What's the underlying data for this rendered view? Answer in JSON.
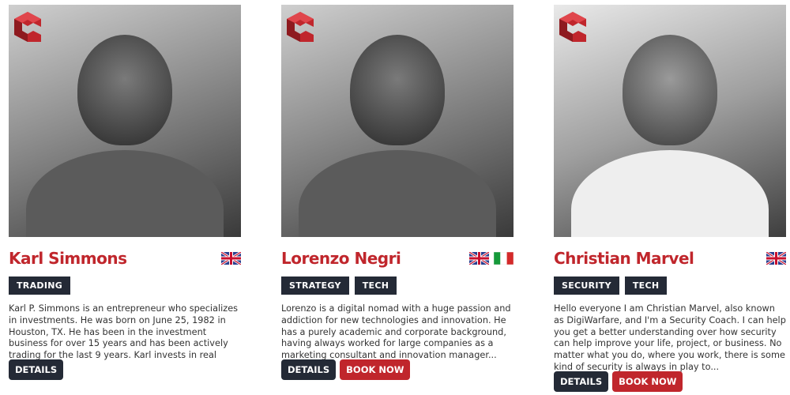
{
  "cards": [
    {
      "name": "Karl Simmons",
      "flags": [
        "uk-flag-icon"
      ],
      "tags": [
        "TRADING"
      ],
      "bio": "Karl P. Simmons is an entrepreneur who specializes in investments. He was born on June 25, 1982 in Houston, TX. He has been in the investment business for over 15 years and has been actively trading for the last 9 years. Karl invests in real estate as well as the...",
      "details_label": "DETAILS"
    },
    {
      "name": "Lorenzo Negri",
      "flags": [
        "uk-flag-icon",
        "italy-flag-icon"
      ],
      "tags": [
        "STRATEGY",
        "TECH"
      ],
      "bio": "Lorenzo is a digital nomad with a huge passion and addiction for new technologies and innovation. He has a purely academic and corporate background, having always worked for large companies as a marketing consultant and innovation manager...",
      "details_label": "DETAILS",
      "book_label": "BOOK NOW"
    },
    {
      "name": "Christian Marvel",
      "flags": [
        "uk-flag-icon"
      ],
      "tags": [
        "SECURITY",
        "TECH"
      ],
      "bio": "Hello everyone I am Christian Marvel, also known as DigiWarfare, and I'm a Security Coach. I can help you get a better understanding over how security can help improve your life, project, or business. No matter what you do, where you work, there is some kind of security is always in play to...",
      "details_label": "DETAILS",
      "book_label": "BOOK NOW"
    }
  ],
  "colors": {
    "accent": "#c0262c",
    "dark": "#242a36"
  }
}
